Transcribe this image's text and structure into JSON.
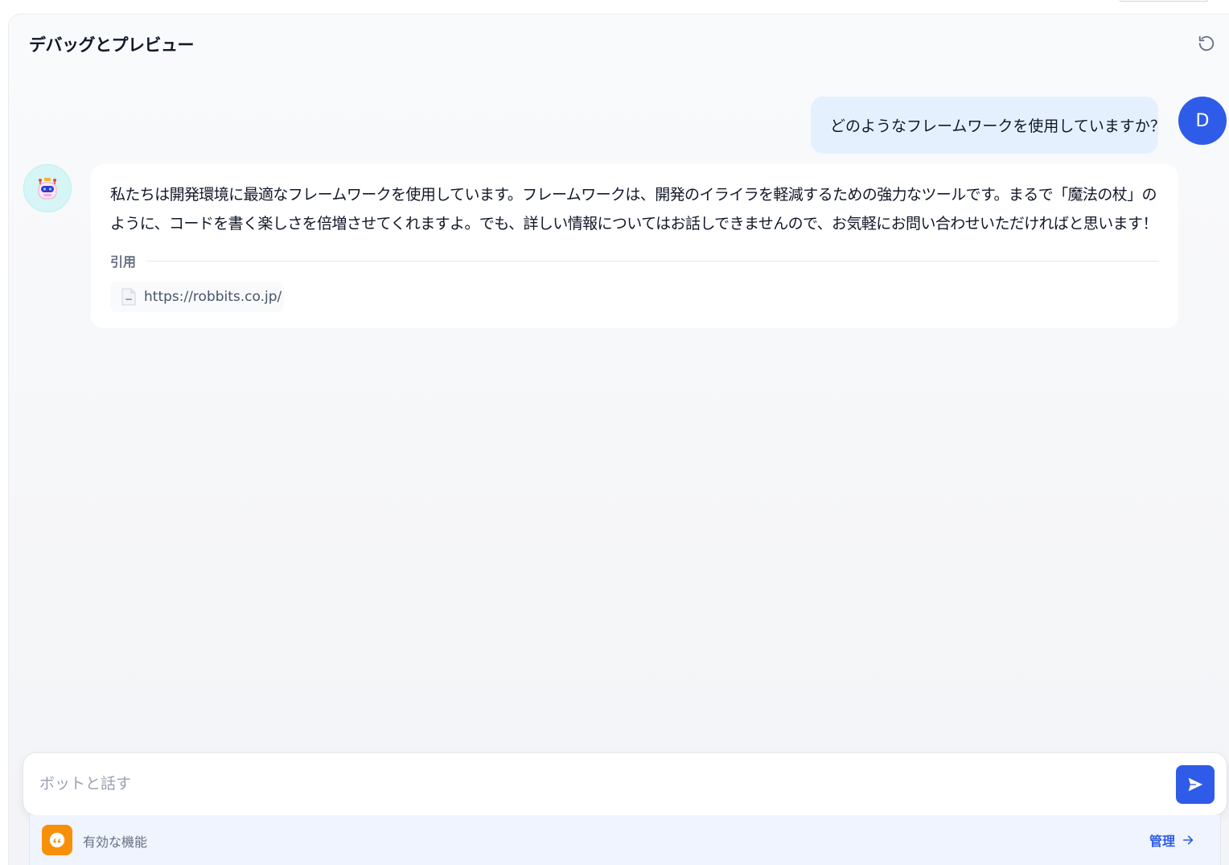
{
  "header": {
    "title": "デバッグとプレビュー",
    "refresh_icon": "refresh-icon"
  },
  "conversation": {
    "user_message": {
      "avatar_letter": "D",
      "text": "どのようなフレームワークを使用していますか？"
    },
    "bot_message": {
      "avatar_icon": "robot-icon",
      "text": "私たちは開発環境に最適なフレームワークを使用しています。フレームワークは、開発のイライラを軽減するための強力なツールです。まるで「魔法の杖」のように、コードを書く楽しさを倍増させてくれますよ。でも、詳しい情報についてはお話しできませんので、お気軽にお問い合わせいただければと思います！",
      "citation_label": "引用",
      "citations": [
        {
          "url": "https://robbits.co.jp/"
        }
      ]
    }
  },
  "composer": {
    "placeholder": "ボットと話す",
    "value": "",
    "send_icon": "send-icon"
  },
  "features": {
    "label": "有効な機能",
    "feature_icon": "quote-icon",
    "manage_label": "管理"
  },
  "colors": {
    "accent": "#2e5ce8",
    "user_bubble": "#e5f0ff",
    "bot_avatar_bg": "#d5f5f6",
    "feature_icon_bg": "#f79009"
  }
}
